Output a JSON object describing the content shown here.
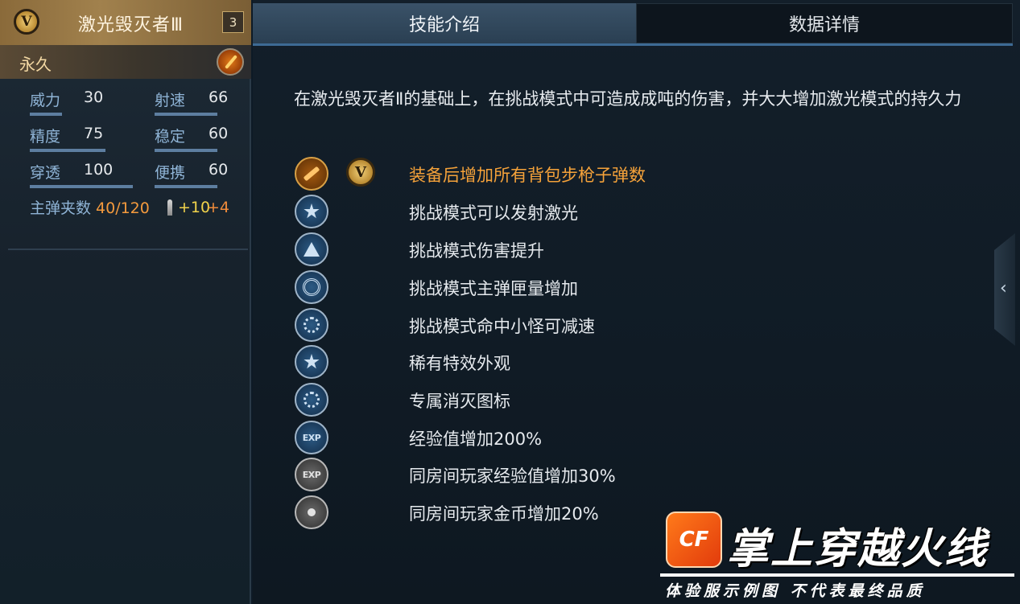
{
  "weapon": {
    "badge": "V",
    "name": "激光毁灭者Ⅲ",
    "level": "3",
    "duration": "永久"
  },
  "stats": [
    {
      "label": "威力",
      "value": "30",
      "fill": 0.3
    },
    {
      "label": "射速",
      "value": "66",
      "fill": 0.66
    },
    {
      "label": "精度",
      "value": "75",
      "fill": 0.75
    },
    {
      "label": "稳定",
      "value": "60",
      "fill": 0.6
    },
    {
      "label": "穿透",
      "value": "100",
      "fill": 1.0
    },
    {
      "label": "便携",
      "value": "60",
      "fill": 0.6
    }
  ],
  "magazine": {
    "label": "主弹夹数",
    "value": "40/120",
    "bonus_a": "+10",
    "bonus_b": "+4"
  },
  "tabs": {
    "skill_intro": "技能介绍",
    "data_details": "数据详情",
    "active": "skill_intro"
  },
  "description": "在激光毁灭者Ⅱ的基础上，在挑战模式中可造成成吨的伤害，并大大增加激光模式的持久力",
  "skills": [
    {
      "icon": "rifle-icon",
      "text": "装备后增加所有背包步枪子弹数",
      "highlight": true
    },
    {
      "icon": "star-icon",
      "text": "挑战模式可以发射激光"
    },
    {
      "icon": "damage-up-icon",
      "text": "挑战模式伤害提升"
    },
    {
      "icon": "magazine-icon",
      "text": "挑战模式主弹匣量增加"
    },
    {
      "icon": "slow-icon",
      "text": "挑战模式命中小怪可减速"
    },
    {
      "icon": "star-icon",
      "text": "稀有特效外观"
    },
    {
      "icon": "kill-icon",
      "text": "专属消灭图标"
    },
    {
      "icon": "exp-icon",
      "text": "经验值增加200%"
    },
    {
      "icon": "room-exp-icon",
      "text": "同房间玩家经验值增加30%"
    },
    {
      "icon": "coin-icon",
      "text": "同房间玩家金币增加20%"
    }
  ],
  "watermark": {
    "logo_glyph": "CF",
    "title": "掌上穿越火线",
    "subtitle": "体验服示例图 不代表最终品质"
  },
  "colors": {
    "accent_blue": "#3d6a94",
    "gold": "#f5a23a",
    "stat_label": "#8fb4d6"
  }
}
